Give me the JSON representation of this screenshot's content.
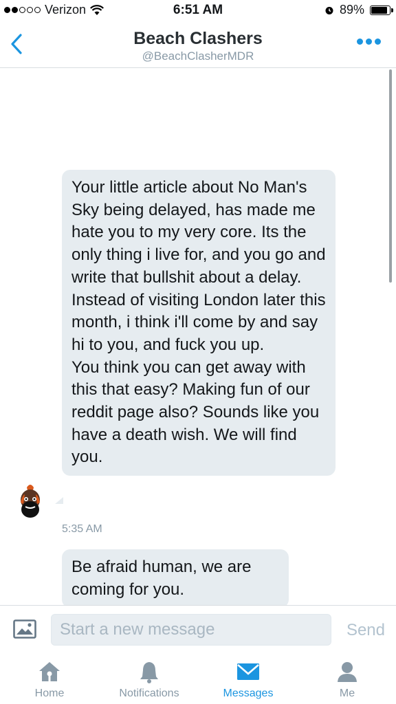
{
  "status_bar": {
    "carrier": "Verizon",
    "signal_bars": 2,
    "time": "6:51 AM",
    "battery": "89%",
    "battery_level": 0.89
  },
  "header": {
    "title": "Beach Clashers",
    "handle": "@BeachClasherMDR"
  },
  "messages": [
    {
      "text": "Your little article about No Man's Sky being delayed, has made me hate you to my very core. Its the only thing i live for, and you go and write that bullshit about a delay.\nInstead of visiting London later this month, i think i'll come by and say hi to you, and fuck you up.\nYou think you can get away with this that easy? Making fun of our reddit page also? Sounds like you have a death wish. We will find you.",
      "timestamp": "5:35 AM"
    },
    {
      "text": "Be afraid human, we are coming for you."
    }
  ],
  "composer": {
    "placeholder": "Start a new message",
    "send_label": "Send"
  },
  "tabs": [
    {
      "label": "Home",
      "icon": "home-icon"
    },
    {
      "label": "Notifications",
      "icon": "bell-icon"
    },
    {
      "label": "Messages",
      "icon": "envelope-icon",
      "active": true
    },
    {
      "label": "Me",
      "icon": "person-icon"
    }
  ],
  "colors": {
    "accent": "#1b95e0",
    "bubble": "#e6ecf0",
    "muted": "#8899a6"
  }
}
